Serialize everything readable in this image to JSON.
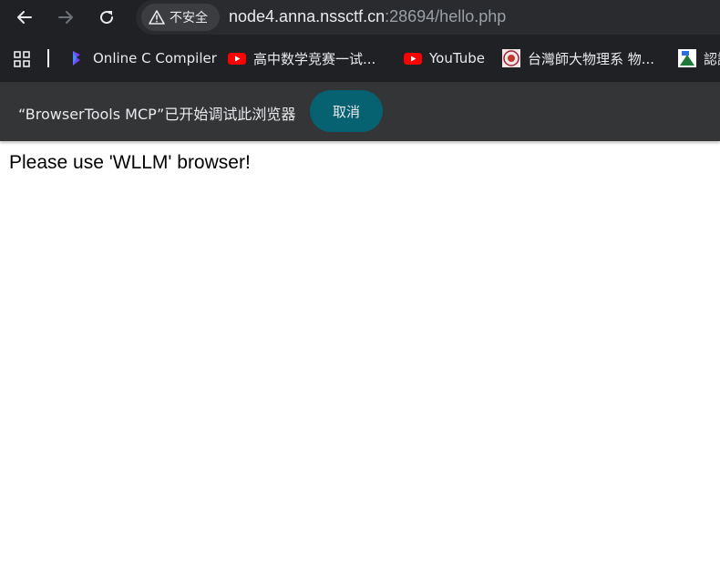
{
  "toolbar": {
    "security_label": "不安全",
    "url_host": "node4.anna.nssctf.cn",
    "url_rest": ":28694/hello.php"
  },
  "bookmarks": [
    {
      "label": "Online C Compiler",
      "icon": "code-compiler-icon"
    },
    {
      "label": "高中数学竞赛一试...",
      "icon": "youtube-icon"
    },
    {
      "label": "YouTube",
      "icon": "youtube-icon"
    },
    {
      "label": "台灣師大物理系 物...",
      "icon": "university-seal-icon"
    },
    {
      "label": "認識",
      "icon": "site-icon"
    }
  ],
  "infobar": {
    "message": "“BrowserTools MCP”已开始调试此浏览器",
    "cancel_label": "取消"
  },
  "page": {
    "text": "Please use 'WLLM' browser!"
  },
  "colors": {
    "chrome_dark": "#202124",
    "infobar": "#333537",
    "cancel_button": "#066270",
    "youtube_red": "#ff0000"
  }
}
